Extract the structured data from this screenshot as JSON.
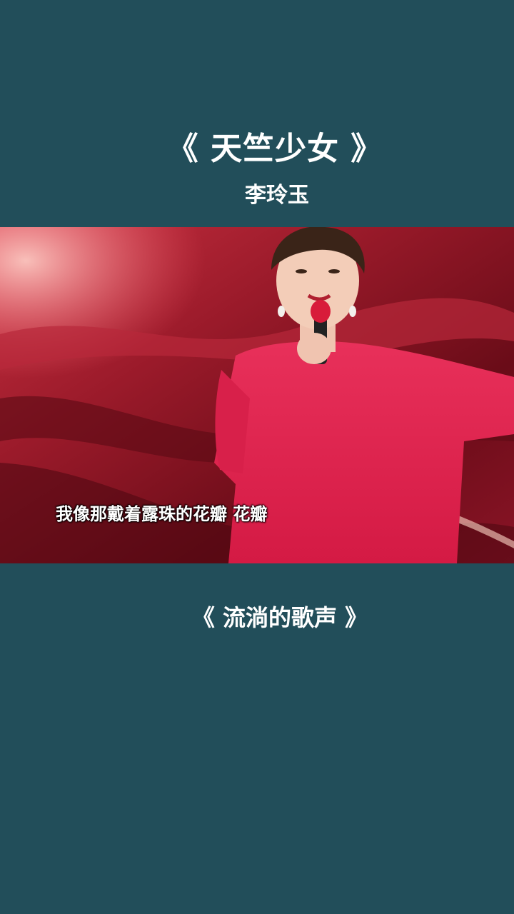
{
  "header": {
    "song_title": "《 天竺少女 》",
    "singer": "李玲玉"
  },
  "video": {
    "lyric": "我像那戴着露珠的花瓣 花瓣"
  },
  "footer": {
    "next_song": "《 流淌的歌声 》"
  },
  "colors": {
    "background": "#224e5a",
    "dress": "#e0204a",
    "stage": "#8c1428"
  }
}
